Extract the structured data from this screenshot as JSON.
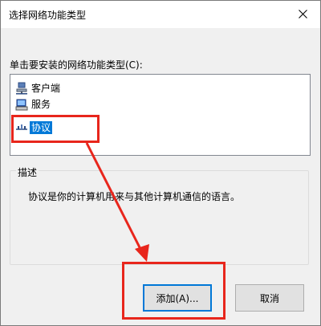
{
  "window": {
    "title": "选择网络功能类型",
    "close_icon": "close-icon"
  },
  "prompt": "单击要安装的网络功能类型(C):",
  "list": {
    "items": [
      {
        "label": "客户端",
        "icon": "client-icon"
      },
      {
        "label": "服务",
        "icon": "service-icon"
      },
      {
        "label": "协议",
        "icon": "protocol-icon",
        "selected": true
      }
    ]
  },
  "description": {
    "title": "描述",
    "text": "协议是你的计算机用来与其他计算机通信的语言。"
  },
  "buttons": {
    "add": "添加(A)...",
    "cancel": "取消"
  },
  "colors": {
    "selection": "#0078d7",
    "annotation": "#e8261c"
  }
}
